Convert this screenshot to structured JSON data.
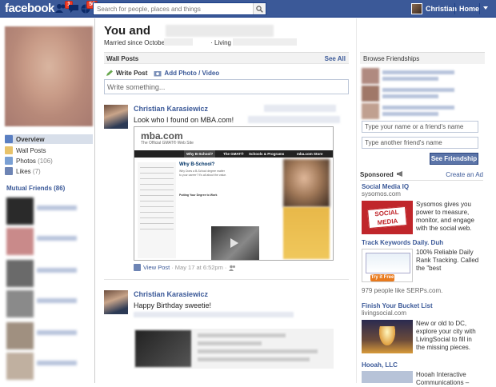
{
  "topbar": {
    "logo": "facebook",
    "notif_friends": "1",
    "notif_messages": "",
    "notif_general": "56",
    "search_placeholder": "Search for people, places and things",
    "user_name": "Christian",
    "home_label": "Home"
  },
  "left_nav": {
    "items": [
      {
        "label": "Overview"
      },
      {
        "label": "Wall Posts"
      },
      {
        "label": "Photos",
        "count": "(106)"
      },
      {
        "label": "Likes",
        "count": "(7)"
      }
    ],
    "mutual_friends_header": "Mutual Friends (86)"
  },
  "main": {
    "title": "You and",
    "married": "Married since October",
    "living_in": "· Living in",
    "wall_posts_header": "Wall Posts",
    "see_all": "See All",
    "composer": {
      "write_post": "Write Post",
      "add_photo": "Add Photo / Video",
      "placeholder": "Write something..."
    },
    "posts": [
      {
        "author": "Christian Karasiewicz",
        "message": "Look who I found on MBA.com!",
        "view_post": "View Post",
        "date": "· May 17 at 6:52pm ·",
        "preview": {
          "logo": "mba.com",
          "tagline": "The Official GMAT® Web Site",
          "nav": [
            "Why B-School?",
            "The GMAT®",
            "Schools & Programs",
            "mba.com Store"
          ],
          "heading": "Why B-School?",
          "blurb": "Why Does a B-School degree matter to your career? It's all about the value.",
          "subheading": "Putting Your Degree to Work"
        }
      },
      {
        "author": "Christian Karasiewicz",
        "message": "Happy Birthday sweetie!"
      }
    ]
  },
  "right": {
    "browse_header": "Browse Friendships",
    "input1_placeholder": "Type your name or a friend's name",
    "input2_placeholder": "Type another friend's name",
    "see_friendship": "See Friendship",
    "sponsored": "Sponsored",
    "create_ad": "Create an Ad",
    "ads": [
      {
        "title": "Social Media IQ",
        "url": "sysomos.com",
        "body": "Sysomos gives you power to measure, monitor, and engage with the social web.",
        "img_text": "SOCIAL MEDIA"
      },
      {
        "title": "Track Keywords Daily. Duh",
        "body": "100% Reliable Daily Rank Tracking. Called the \"best",
        "footer": "979 people like SERPs.com.",
        "img_button": "Try it Free"
      },
      {
        "title": "Finish Your Bucket List",
        "url": "livingsocial.com",
        "body": "New or old to DC, explore your city with LivingSocial to fill in the missing pieces."
      },
      {
        "title": "Hooah, LLC",
        "body": "Hooah Interactive Communications –"
      }
    ]
  },
  "colors": {
    "brand": "#3b5998",
    "badge": "#f03d25"
  }
}
